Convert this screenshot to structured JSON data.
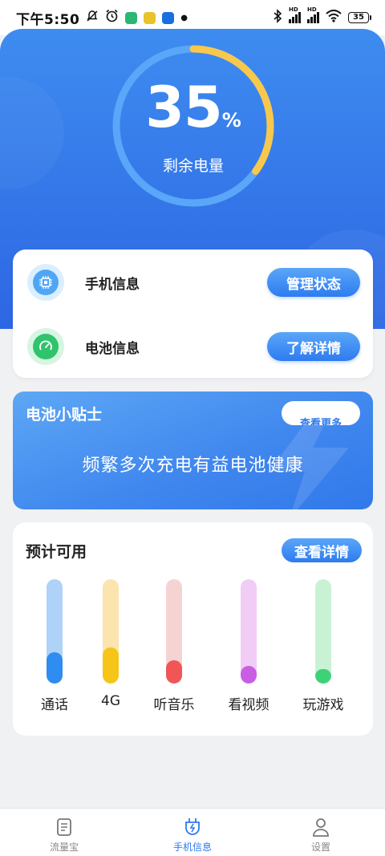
{
  "status_bar": {
    "time": "下午5:50",
    "battery_level": "35",
    "hd1": "HD",
    "hd2": "HD"
  },
  "hero": {
    "battery_percent": "35",
    "percent_sign": "%",
    "label": "剩余电量",
    "progress": 0.35,
    "colors": {
      "progress": "#f8c84c",
      "track": "#5aa6f8"
    }
  },
  "info_card": {
    "rows": [
      {
        "label": "手机信息",
        "button": "管理状态",
        "icon": "chip-icon"
      },
      {
        "label": "电池信息",
        "button": "了解详情",
        "icon": "gauge-icon"
      }
    ]
  },
  "tips_card": {
    "title": "电池小贴士",
    "more_button": "查看更多",
    "text": "频繁多次充电有益电池健康"
  },
  "estimate_card": {
    "title": "预计可用",
    "detail_button": "查看详情",
    "items": [
      {
        "label": "通话",
        "level": 0.3,
        "track_color": "#aed2f8",
        "fill_color": "#2f8cf0"
      },
      {
        "label": "4G",
        "level": 0.35,
        "track_color": "#fbe4ae",
        "fill_color": "#f5c518"
      },
      {
        "label": "听音乐",
        "level": 0.22,
        "track_color": "#f6d3d3",
        "fill_color": "#f05656"
      },
      {
        "label": "看视频",
        "level": 0.17,
        "track_color": "#f1cdf6",
        "fill_color": "#c95ee4"
      },
      {
        "label": "玩游戏",
        "level": 0.14,
        "track_color": "#c9f2d4",
        "fill_color": "#3ed277"
      }
    ]
  },
  "bottom_nav": {
    "items": [
      {
        "label": "流量宝",
        "icon": "document-icon",
        "active": false
      },
      {
        "label": "手机信息",
        "icon": "charging-icon",
        "active": true
      },
      {
        "label": "设置",
        "icon": "person-icon",
        "active": false
      }
    ]
  }
}
